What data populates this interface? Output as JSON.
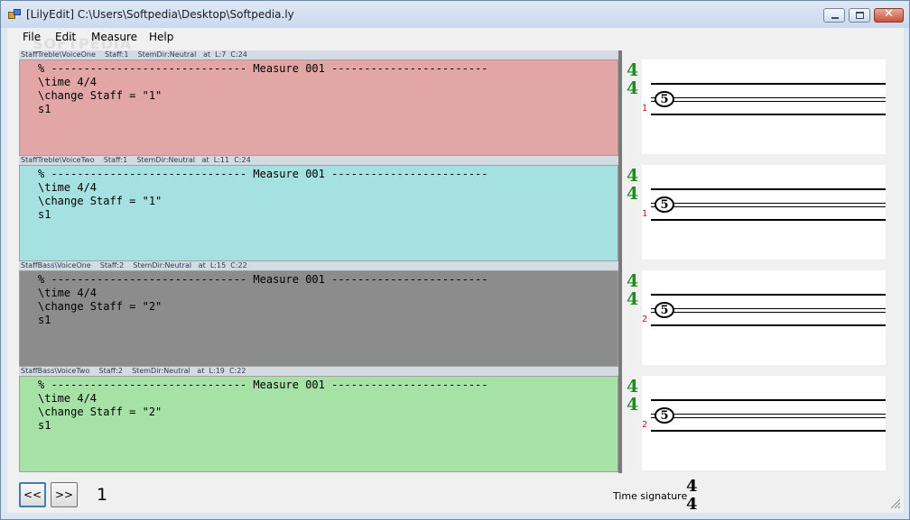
{
  "window": {
    "title": "[LilyEdit] C:\\Users\\Softpedia\\Desktop\\Softpedia.ly"
  },
  "menu": [
    "File",
    "Edit",
    "Measure",
    "Help"
  ],
  "watermark": "SOFTPEDIA",
  "voices": [
    {
      "header": "StaffTreble\\VoiceOne    Staff:1    StemDir:Neutral   at  L:7  C:24",
      "color": "#e2a6a6",
      "lines": [
        "% ------------------------------ Measure 001 ------------------------",
        "\\time 4/4",
        "\\change Staff = \"1\"",
        "s1"
      ],
      "timesig": {
        "top": "4",
        "bottom": "4"
      },
      "staff_num": "1"
    },
    {
      "header": "StaffTreble\\VoiceTwo    Staff:1    StemDir:Neutral   at  L:11  C:24",
      "color": "#a6e1e1",
      "lines": [
        "% ------------------------------ Measure 001 ------------------------",
        "\\time 4/4",
        "\\change Staff = \"1\"",
        "s1"
      ],
      "timesig": {
        "top": "4",
        "bottom": "4"
      },
      "staff_num": "1"
    },
    {
      "header": "StaffBass\\VoiceOne    Staff:2    StemDir:Neutral   at  L:15  C:22",
      "color": "#8c8c8c",
      "lines": [
        "% ------------------------------ Measure 001 ------------------------",
        "\\time 4/4",
        "\\change Staff = \"2\"",
        "s1"
      ],
      "timesig": {
        "top": "4",
        "bottom": "4"
      },
      "staff_num": "2"
    },
    {
      "header": "StaffBass\\VoiceTwo    Staff:2    StemDir:Neutral   at  L:19  C:22",
      "color": "#a6e1a6",
      "lines": [
        "% ------------------------------ Measure 001 ------------------------",
        "\\time 4/4",
        "\\change Staff = \"2\"",
        "s1"
      ],
      "timesig": {
        "top": "4",
        "bottom": "4"
      },
      "staff_num": "2"
    }
  ],
  "staff_symbol": "5",
  "nav": {
    "prev": "<<",
    "next": ">>",
    "measure": "1"
  },
  "time_signature": {
    "label": "Time signature",
    "top": "4",
    "bottom": "4"
  },
  "colors": {
    "timesig_green": "#228b22",
    "staff_number_red": "#c41a1a"
  }
}
